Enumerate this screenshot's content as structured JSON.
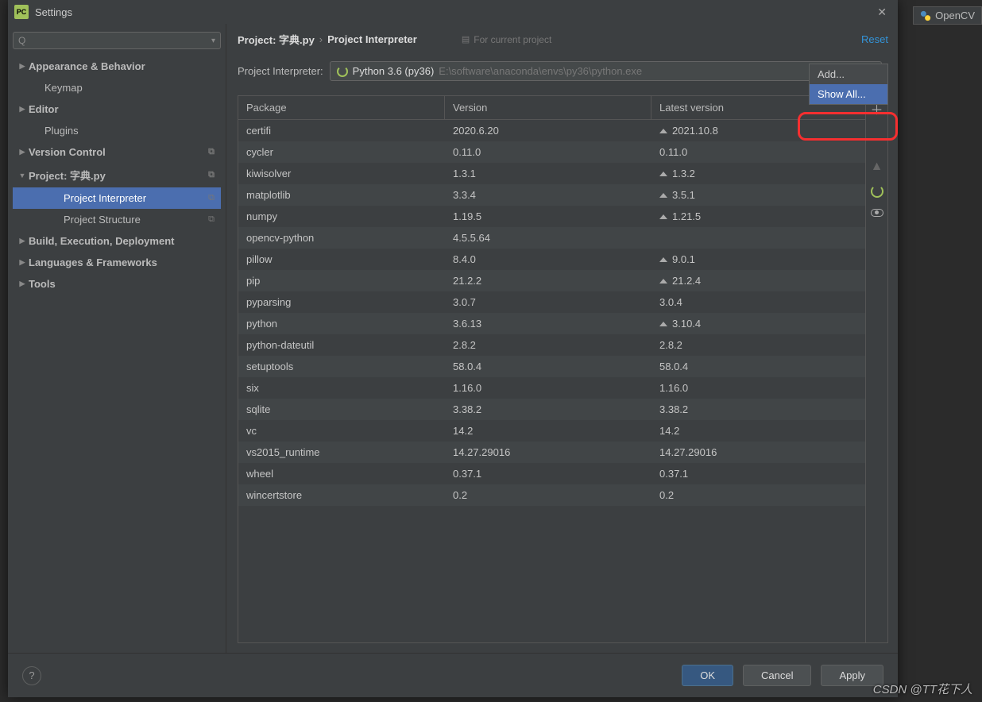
{
  "bg_tab": {
    "label": "OpenCV"
  },
  "dialog": {
    "title": "Settings",
    "search_placeholder": "",
    "tree": [
      {
        "label": "Appearance & Behavior",
        "arrow": "▶",
        "bold": true
      },
      {
        "label": "Keymap",
        "arrow": "",
        "sub": true,
        "pad": "sub2"
      },
      {
        "label": "Editor",
        "arrow": "▶",
        "bold": true
      },
      {
        "label": "Plugins",
        "arrow": "",
        "sub": true,
        "pad": "sub2"
      },
      {
        "label": "Version Control",
        "arrow": "▶",
        "bold": true,
        "dup": true
      },
      {
        "label": "Project: 字典.py",
        "arrow": "▼",
        "bold": true,
        "dup": true
      },
      {
        "label": "Project Interpreter",
        "arrow": "",
        "sub": true,
        "selected": true,
        "dup": true
      },
      {
        "label": "Project Structure",
        "arrow": "",
        "sub": true,
        "dup": true
      },
      {
        "label": "Build, Execution, Deployment",
        "arrow": "▶",
        "bold": true
      },
      {
        "label": "Languages & Frameworks",
        "arrow": "▶",
        "bold": true
      },
      {
        "label": "Tools",
        "arrow": "▶",
        "bold": true
      }
    ],
    "breadcrumb": {
      "c1": "Project: 字典.py",
      "c2": "Project Interpreter",
      "note": "For current project",
      "reset": "Reset"
    },
    "interpreter": {
      "label": "Project Interpreter:",
      "name": "Python 3.6 (py36)",
      "path": "E:\\software\\anaconda\\envs\\py36\\python.exe"
    },
    "dropdown": {
      "add": "Add...",
      "show_all": "Show All..."
    },
    "table": {
      "headers": {
        "pkg": "Package",
        "ver": "Version",
        "latest": "Latest version"
      },
      "rows": [
        {
          "p": "certifi",
          "v": "2020.6.20",
          "l": "2021.10.8",
          "up": true
        },
        {
          "p": "cycler",
          "v": "0.11.0",
          "l": "0.11.0"
        },
        {
          "p": "kiwisolver",
          "v": "1.3.1",
          "l": "1.3.2",
          "up": true
        },
        {
          "p": "matplotlib",
          "v": "3.3.4",
          "l": "3.5.1",
          "up": true
        },
        {
          "p": "numpy",
          "v": "1.19.5",
          "l": "1.21.5",
          "up": true
        },
        {
          "p": "opencv-python",
          "v": "4.5.5.64",
          "l": ""
        },
        {
          "p": "pillow",
          "v": "8.4.0",
          "l": "9.0.1",
          "up": true
        },
        {
          "p": "pip",
          "v": "21.2.2",
          "l": "21.2.4",
          "up": true
        },
        {
          "p": "pyparsing",
          "v": "3.0.7",
          "l": "3.0.4"
        },
        {
          "p": "python",
          "v": "3.6.13",
          "l": "3.10.4",
          "up": true
        },
        {
          "p": "python-dateutil",
          "v": "2.8.2",
          "l": "2.8.2"
        },
        {
          "p": "setuptools",
          "v": "58.0.4",
          "l": "58.0.4"
        },
        {
          "p": "six",
          "v": "1.16.0",
          "l": "1.16.0"
        },
        {
          "p": "sqlite",
          "v": "3.38.2",
          "l": "3.38.2"
        },
        {
          "p": "vc",
          "v": "14.2",
          "l": "14.2"
        },
        {
          "p": "vs2015_runtime",
          "v": "14.27.29016",
          "l": "14.27.29016"
        },
        {
          "p": "wheel",
          "v": "0.37.1",
          "l": "0.37.1"
        },
        {
          "p": "wincertstore",
          "v": "0.2",
          "l": "0.2"
        }
      ]
    },
    "footer": {
      "ok": "OK",
      "cancel": "Cancel",
      "apply": "Apply"
    }
  },
  "watermark": "CSDN @TT花下人"
}
